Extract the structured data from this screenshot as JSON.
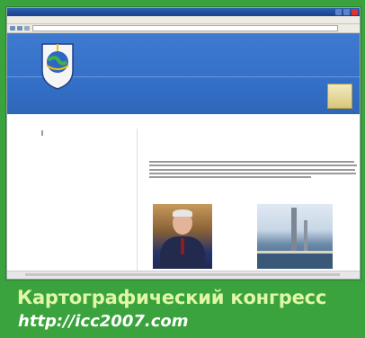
{
  "caption": {
    "title": "Картографический конгресс",
    "url": "http://icc2007.com"
  },
  "colors": {
    "background": "#3aa33d",
    "banner": "#3470c8",
    "caption_text": "#dff7a6"
  },
  "icons": {
    "logo": "globe-emblem-icon",
    "badge": "award-badge-icon"
  }
}
